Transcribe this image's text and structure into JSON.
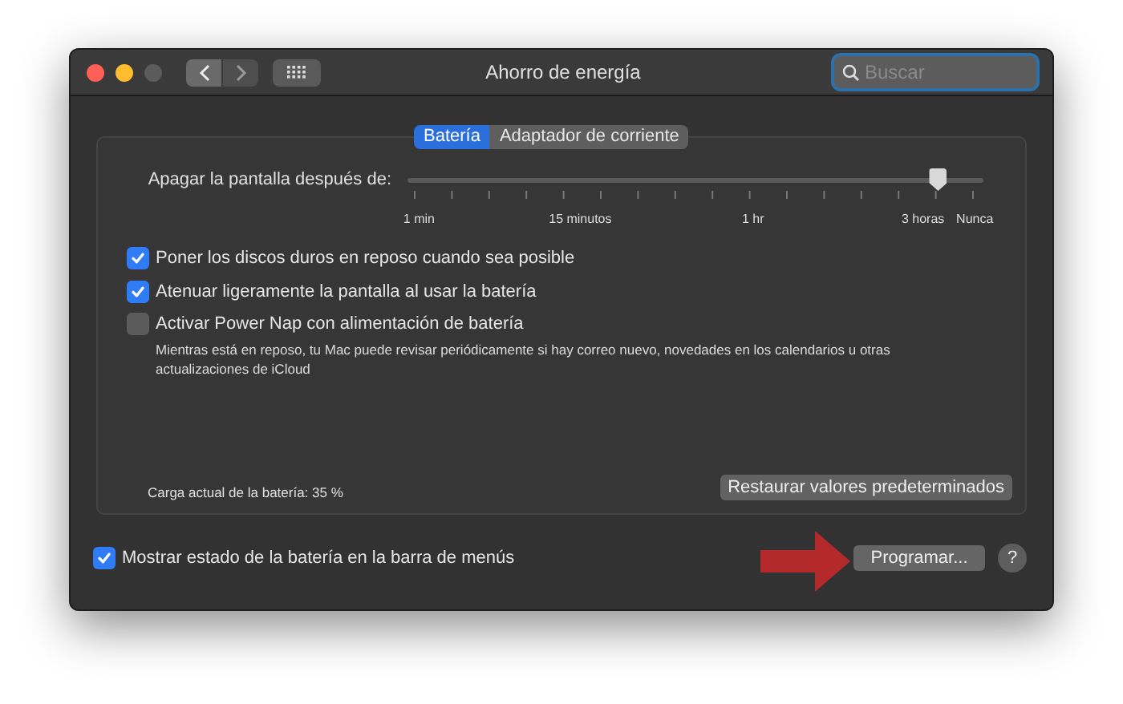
{
  "window": {
    "title": "Ahorro de energía"
  },
  "search": {
    "placeholder": "Buscar"
  },
  "tabs": [
    {
      "label": "Batería",
      "selected": true
    },
    {
      "label": "Adaptador de corriente",
      "selected": false
    }
  ],
  "slider": {
    "label": "Apagar la pantalla después de:",
    "level": 0.92,
    "ticks": [
      "1 min",
      "15 minutos",
      "1 hr",
      "3 horas",
      "Nunca"
    ]
  },
  "options": [
    {
      "label": "Poner los discos duros en reposo cuando sea posible",
      "checked": true
    },
    {
      "label": "Atenuar ligeramente la pantalla al usar la batería",
      "checked": true
    },
    {
      "label": "Activar Power Nap con alimentación de batería",
      "checked": false,
      "note": "Mientras está en reposo, tu Mac puede revisar periódicamente si hay correo nuevo, novedades en los calendarios u otras actualizaciones de iCloud"
    }
  ],
  "battery_charge": "Carga actual de la batería: 35 %",
  "restore_button": "Restaurar valores predeterminados",
  "menu_bar_option": {
    "label": "Mostrar estado de la batería en la barra de menús",
    "checked": true
  },
  "schedule_button": "Programar...",
  "help_button": "?"
}
